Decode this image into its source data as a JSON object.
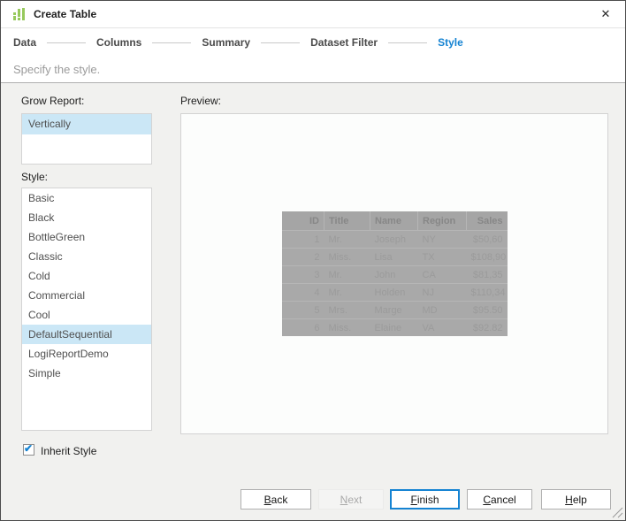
{
  "window": {
    "title": "Create Table",
    "close_glyph": "✕"
  },
  "steps": {
    "items": [
      {
        "label": "Data"
      },
      {
        "label": "Columns"
      },
      {
        "label": "Summary"
      },
      {
        "label": "Dataset Filter"
      },
      {
        "label": "Style"
      }
    ],
    "active_index": 4
  },
  "subtitle": "Specify the style.",
  "grow_report": {
    "label": "Grow Report:",
    "options": [
      {
        "label": "Vertically",
        "selected": true
      }
    ]
  },
  "style_list": {
    "label": "Style:",
    "options": [
      {
        "label": "Basic"
      },
      {
        "label": "Black"
      },
      {
        "label": "BottleGreen"
      },
      {
        "label": "Classic"
      },
      {
        "label": "Cold"
      },
      {
        "label": "Commercial"
      },
      {
        "label": "Cool"
      },
      {
        "label": "DefaultSequential",
        "selected": true
      },
      {
        "label": "LogiReportDemo"
      },
      {
        "label": "Simple"
      }
    ]
  },
  "preview": {
    "label": "Preview:",
    "table": {
      "columns": [
        "ID",
        "Title",
        "Name",
        "Region",
        "Sales"
      ],
      "rows": [
        [
          "1",
          "Mr.",
          "Joseph",
          "NY",
          "$50,60"
        ],
        [
          "2",
          "Miss.",
          "Lisa",
          "TX",
          "$108,90"
        ],
        [
          "3",
          "Mr.",
          "John",
          "CA",
          "$81,35"
        ],
        [
          "4",
          "Mr.",
          "Holden",
          "NJ",
          "$110,34"
        ],
        [
          "5",
          "Mrs.",
          "Marge",
          "MD",
          "$95.50"
        ],
        [
          "6",
          "Miss.",
          "Elaine",
          "VA",
          "$92.82"
        ]
      ]
    }
  },
  "inherit_style": {
    "label": "Inherit Style",
    "checked": true
  },
  "buttons": {
    "back": "Back",
    "next": "Next",
    "finish": "Finish",
    "cancel": "Cancel",
    "help": "Help"
  },
  "colors": {
    "accent_blue": "#1583d2",
    "selection_blue": "#cbe7f6",
    "icon_green": "#97c95c",
    "preview_gray": "#a9a9a9"
  }
}
